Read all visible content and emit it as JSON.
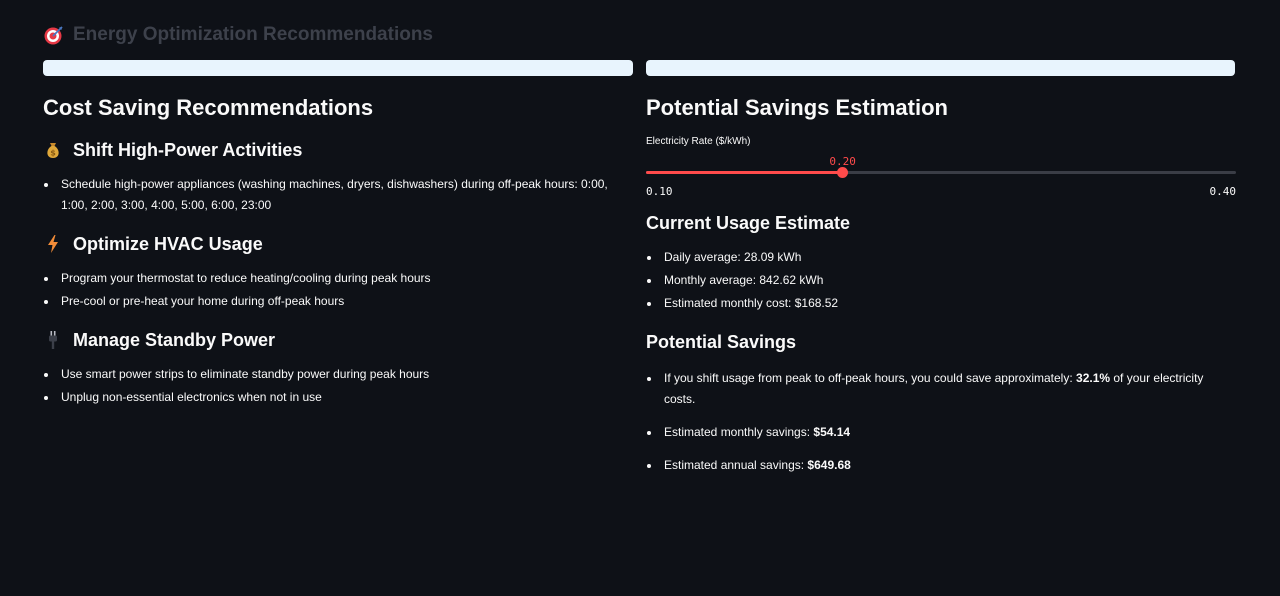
{
  "page": {
    "title": "Energy Optimization Recommendations",
    "title_icon": "target-icon"
  },
  "colors": {
    "background": "#0e1117",
    "text": "#fafafa",
    "muted_title": "#3d414b",
    "info_bar": "#e8f4fd",
    "accent": "#ff4b4b",
    "track": "#3a3d46"
  },
  "left": {
    "heading": "Cost Saving Recommendations",
    "sections": [
      {
        "icon": "money-bag-icon",
        "title": "Shift High-Power Activities",
        "items": [
          "Schedule high-power appliances (washing machines, dryers, dishwashers) during off-peak hours: 0:00, 1:00, 2:00, 3:00, 4:00, 5:00, 6:00, 23:00"
        ]
      },
      {
        "icon": "lightning-icon",
        "title": "Optimize HVAC Usage",
        "items": [
          "Program your thermostat to reduce heating/cooling during peak hours",
          "Pre-cool or pre-heat your home during off-peak hours"
        ]
      },
      {
        "icon": "plug-icon",
        "title": "Manage Standby Power",
        "items": [
          "Use smart power strips to eliminate standby power during peak hours",
          "Unplug non-essential electronics when not in use"
        ]
      }
    ]
  },
  "right": {
    "heading": "Potential Savings Estimation",
    "slider": {
      "label": "Electricity Rate ($/kWh)",
      "value": 0.2,
      "value_label": "0.20",
      "min": 0.1,
      "max": 0.4,
      "min_label": "0.10",
      "max_label": "0.40"
    },
    "usage": {
      "heading": "Current Usage Estimate",
      "items": [
        "Daily average: 28.09 kWh",
        "Monthly average: 842.62 kWh",
        "Estimated monthly cost: $168.52"
      ]
    },
    "savings": {
      "heading": "Potential Savings",
      "item1_prefix": "If you shift usage from peak to off-peak hours, you could save approximately: ",
      "item1_value": "32.1%",
      "item1_suffix": " of your electricity costs.",
      "item2_prefix": "Estimated monthly savings: ",
      "item2_value": "$54.14",
      "item3_prefix": "Estimated annual savings: ",
      "item3_value": "$649.68"
    }
  }
}
